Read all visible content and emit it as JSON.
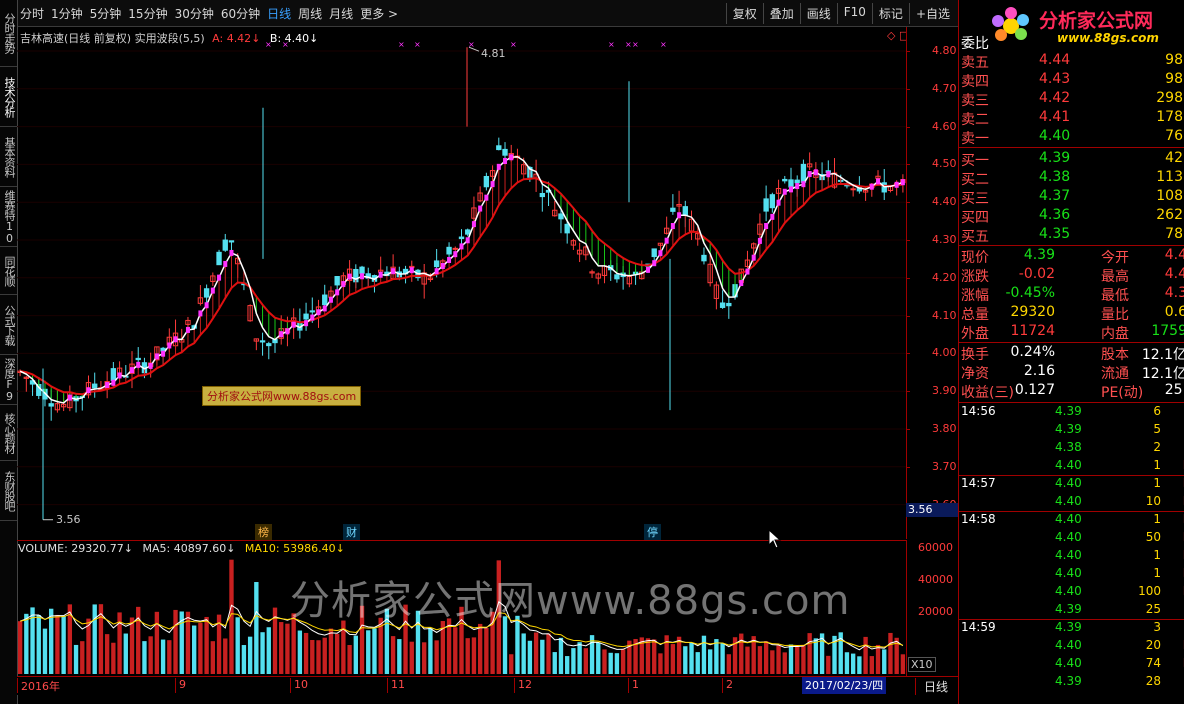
{
  "toolbar": {
    "periods": [
      "分时",
      "1分钟",
      "5分钟",
      "15分钟",
      "30分钟",
      "60分钟",
      "日线",
      "周线",
      "月线",
      "更多 >"
    ],
    "active_period": "日线",
    "right_tools": [
      "复权",
      "叠加",
      "画线",
      "F10",
      "标记",
      "+自选"
    ]
  },
  "left_tabs": [
    "分时走势",
    "技术分析",
    "基本资料",
    "维赛特10",
    "同花顺",
    "公式下载",
    "深度F9",
    "核心题材",
    "东财股吧"
  ],
  "main_legend": {
    "title": "吉林高速(日线 前复权) 实用波段(5,5)",
    "a_label": "A: 4.42",
    "b_label": "B: 4.40"
  },
  "price_axis": [
    "4.80",
    "4.70",
    "4.60",
    "4.50",
    "4.40",
    "4.30",
    "4.20",
    "4.10",
    "4.00",
    "3.90",
    "3.80",
    "3.70",
    "3.60"
  ],
  "price_cursor": "3.56",
  "annotations": {
    "high": "4.81",
    "low": "3.56"
  },
  "flags": [
    "榜",
    "财",
    "停"
  ],
  "watermark_small": "分析家公式网www.88gs.com",
  "watermark_big": "分析家公式网www.88gs.com",
  "volume_legend": {
    "volume": "VOLUME: 29320.77",
    "ma5": "MA5: 40897.60",
    "ma10": "MA10: 53986.40"
  },
  "volume_axis": [
    "60000",
    "40000",
    "20000"
  ],
  "volume_unit": "X10",
  "date_axis": [
    "2016年",
    "9",
    "10",
    "11",
    "12",
    "1",
    "2"
  ],
  "date_cursor": "2017/02/23/四",
  "date_axis_right": "日线",
  "logo": {
    "text": "分析家公式网",
    "url": "www.88gs.com"
  },
  "quote": {
    "header": "委比",
    "asks": [
      {
        "label": "卖五",
        "price": "4.44",
        "vol": "98"
      },
      {
        "label": "卖四",
        "price": "4.43",
        "vol": "98"
      },
      {
        "label": "卖三",
        "price": "4.42",
        "vol": "298"
      },
      {
        "label": "卖二",
        "price": "4.41",
        "vol": "178"
      },
      {
        "label": "卖一",
        "price": "4.40",
        "vol": "76"
      }
    ],
    "bids": [
      {
        "label": "买一",
        "price": "4.39",
        "vol": "42"
      },
      {
        "label": "买二",
        "price": "4.38",
        "vol": "113"
      },
      {
        "label": "买三",
        "price": "4.37",
        "vol": "108"
      },
      {
        "label": "买四",
        "price": "4.36",
        "vol": "262"
      },
      {
        "label": "买五",
        "price": "4.35",
        "vol": "78"
      }
    ],
    "stats": [
      {
        "l1": "现价",
        "v1": "4.39",
        "l2": "今开",
        "v2": "4.4"
      },
      {
        "l1": "涨跌",
        "v1": "-0.02",
        "l2": "最高",
        "v2": "4.4"
      },
      {
        "l1": "涨幅",
        "v1": "-0.45%",
        "l2": "最低",
        "v2": "4.3"
      },
      {
        "l1": "总量",
        "v1": "29320",
        "l2": "量比",
        "v2": "0.6"
      },
      {
        "l1": "外盘",
        "v1": "11724",
        "l2": "内盘",
        "v2": "1759"
      }
    ],
    "stats2": [
      {
        "l1": "换手",
        "v1": "0.24%",
        "l2": "股本",
        "v2": "12.1亿"
      },
      {
        "l1": "净资",
        "v1": "2.16",
        "l2": "流通",
        "v2": "12.1亿"
      },
      {
        "l1": "收益(三)",
        "v1": "0.127",
        "l2": "PE(动)",
        "v2": "25."
      }
    ],
    "ticks": [
      {
        "time": "14:56",
        "price": "4.39",
        "vol": "6",
        "side": "S"
      },
      {
        "time": "",
        "price": "4.39",
        "vol": "5",
        "side": "S"
      },
      {
        "time": "",
        "price": "4.38",
        "vol": "2",
        "side": "S"
      },
      {
        "time": "",
        "price": "4.40",
        "vol": "1",
        "side": "B"
      },
      {
        "time": "14:57",
        "price": "4.40",
        "vol": "1",
        "side": "B"
      },
      {
        "time": "",
        "price": "4.40",
        "vol": "10",
        "side": "B"
      },
      {
        "time": "14:58",
        "price": "4.40",
        "vol": "1",
        "side": "B"
      },
      {
        "time": "",
        "price": "4.40",
        "vol": "50",
        "side": "B"
      },
      {
        "time": "",
        "price": "4.40",
        "vol": "1",
        "side": "B"
      },
      {
        "time": "",
        "price": "4.40",
        "vol": "1",
        "side": "B"
      },
      {
        "time": "",
        "price": "4.40",
        "vol": "100",
        "side": "B"
      },
      {
        "time": "",
        "price": "4.39",
        "vol": "25",
        "side": "S"
      },
      {
        "time": "14:59",
        "price": "4.39",
        "vol": "3",
        "side": "S"
      },
      {
        "time": "",
        "price": "4.40",
        "vol": "20",
        "side": "B"
      },
      {
        "time": "",
        "price": "4.40",
        "vol": "74",
        "side": "B"
      },
      {
        "time": "",
        "price": "4.39",
        "vol": "28",
        "side": "S"
      }
    ]
  },
  "colors": {
    "up": "#ff3b3b",
    "down": "#54e0f0",
    "frame": "#a00000",
    "magenta": "#ff33ff",
    "green_band": "#18c818"
  }
}
